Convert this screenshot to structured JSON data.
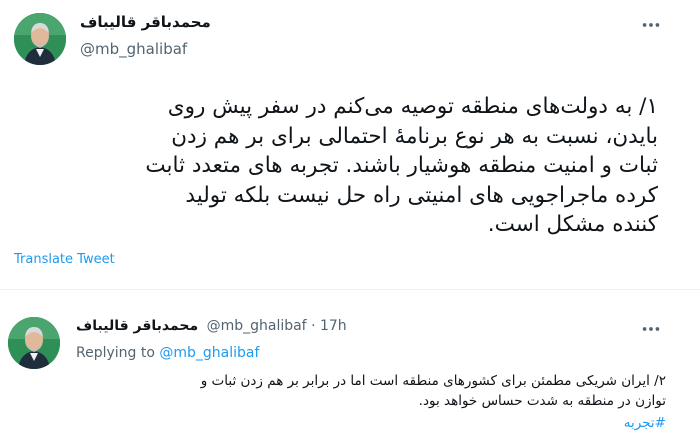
{
  "main_tweet": {
    "author_name": "محمدباقر قالیباف",
    "handle": "@mb_ghalibaf",
    "body": "۱/ به دولت‌های منطقه توصیه می‌کنم در سفر پیش روی\nبایدن، نسبت به هر نوع برنامهٔ احتمالی برای بر هم زدن\nثبات و امنیت منطقه هوشیار باشند. تجربه های متعدد ثابت\nکرده ماجراجویی های امنیتی راه حل نیست بلکه تولید\nکننده مشکل است.",
    "translate_label": "Translate Tweet",
    "more_icon": "more-icon"
  },
  "reply_tweet": {
    "author_name": "محمدباقر قالیباف",
    "meta": "@mb_ghalibaf · 17h",
    "replying_prefix": "Replying to ",
    "replying_handle": "@mb_ghalibaf",
    "body": "۲/ ایران شریکی مطمئن برای کشورهای منطقه است اما در برابر بر هم زدن ثبات و\nتوازن در منطقه به شدت حساس خواهد بود.",
    "hashtag": "#تجربه",
    "more_icon": "more-icon"
  },
  "colors": {
    "link": "#1d9bf0",
    "muted": "#536471",
    "text": "#0f1419",
    "avatar_bg": "#2e8f57"
  }
}
